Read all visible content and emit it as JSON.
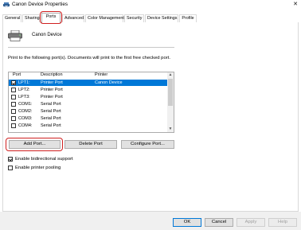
{
  "window": {
    "title": "Canon Device Properties",
    "close_glyph": "✕"
  },
  "tabs": [
    {
      "label": "General"
    },
    {
      "label": "Sharing"
    },
    {
      "label": "Ports"
    },
    {
      "label": "Advanced"
    },
    {
      "label": "Color Management"
    },
    {
      "label": "Security"
    },
    {
      "label": "Device Settings"
    },
    {
      "label": "Profile"
    }
  ],
  "active_tab": "Ports",
  "device_name": "Canon Device",
  "description": "Print to the following port(s). Documents will print to the first free checked port.",
  "ports_table": {
    "columns": [
      "Port",
      "Description",
      "Printer"
    ],
    "rows": [
      {
        "checked": true,
        "port": "LPT1:",
        "description": "Printer Port",
        "printer": "Canon Device",
        "selected": true
      },
      {
        "checked": false,
        "port": "LPT2:",
        "description": "Printer Port",
        "printer": ""
      },
      {
        "checked": false,
        "port": "LPT3:",
        "description": "Printer Port",
        "printer": ""
      },
      {
        "checked": false,
        "port": "COM1:",
        "description": "Serial Port",
        "printer": ""
      },
      {
        "checked": false,
        "port": "COM2:",
        "description": "Serial Port",
        "printer": ""
      },
      {
        "checked": false,
        "port": "COM3:",
        "description": "Serial Port",
        "printer": ""
      },
      {
        "checked": false,
        "port": "COM4:",
        "description": "Serial Port",
        "printer": ""
      }
    ]
  },
  "buttons": {
    "add_port": "Add Port...",
    "delete_port": "Delete Port",
    "configure_port": "Configure Port..."
  },
  "options": {
    "bidirectional": {
      "label": "Enable bidirectional support",
      "checked": true
    },
    "pooling": {
      "label": "Enable printer pooling",
      "checked": false
    }
  },
  "footer": {
    "ok": "OK",
    "cancel": "Cancel",
    "apply": "Apply",
    "help": "Help"
  },
  "colors": {
    "selection": "#0078d7",
    "highlight": "#d02020"
  }
}
